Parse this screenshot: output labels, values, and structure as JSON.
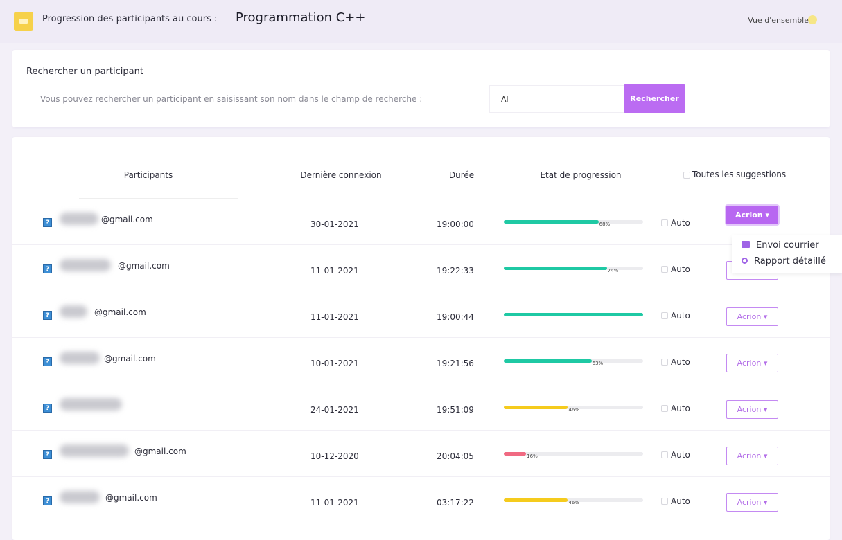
{
  "header": {
    "title_prefix": "Progression des participants au cours :",
    "course": "Programmation C++",
    "overview_link": "Vue d'ensemble"
  },
  "search": {
    "title": "Rechercher un participant",
    "description": "Vous pouvez rechercher un participant en saisissant son nom dans le champ de recherche :",
    "value": "Al",
    "button": "Rechercher"
  },
  "table": {
    "columns": {
      "participants": "Participants",
      "last_connection": "Dernière connexion",
      "duration": "Durée",
      "progress": "Etat de progression",
      "suggestions": "Toutes les suggestions"
    },
    "auto_label": "Auto",
    "action_label": "Acrion ▾",
    "rows": [
      {
        "email": "@gmail.com",
        "date": "30-01-2021",
        "duration": "19:00:00",
        "progress": 0.68,
        "progress_label": "68%",
        "color": "#1fc9a4"
      },
      {
        "email": "@gmail.com",
        "date": "11-01-2021",
        "duration": "19:22:33",
        "progress": 0.74,
        "progress_label": "74%",
        "color": "#1fc9a4"
      },
      {
        "email": "@gmail.com",
        "date": "11-01-2021",
        "duration": "19:00:44",
        "progress": 1.0,
        "progress_label": "",
        "color": "#1fc9a4"
      },
      {
        "email": "@gmail.com",
        "date": "10-01-2021",
        "duration": "19:21:56",
        "progress": 0.63,
        "progress_label": "63%",
        "color": "#1fc9a4"
      },
      {
        "email": "",
        "date": "24-01-2021",
        "duration": "19:51:09",
        "progress": 0.46,
        "progress_label": "46%",
        "color": "#f5cb1d"
      },
      {
        "email": "@gmail.com",
        "date": "10-12-2020",
        "duration": "20:04:05",
        "progress": 0.16,
        "progress_label": "16%",
        "color": "#f06a82"
      },
      {
        "email": "@gmail.com",
        "date": "11-01-2021",
        "duration": "03:17:22",
        "progress": 0.46,
        "progress_label": "46%",
        "color": "#f5cb1d"
      }
    ]
  },
  "dropdown": {
    "items": [
      "Envoi courrier",
      "Rapport détaillé"
    ]
  }
}
